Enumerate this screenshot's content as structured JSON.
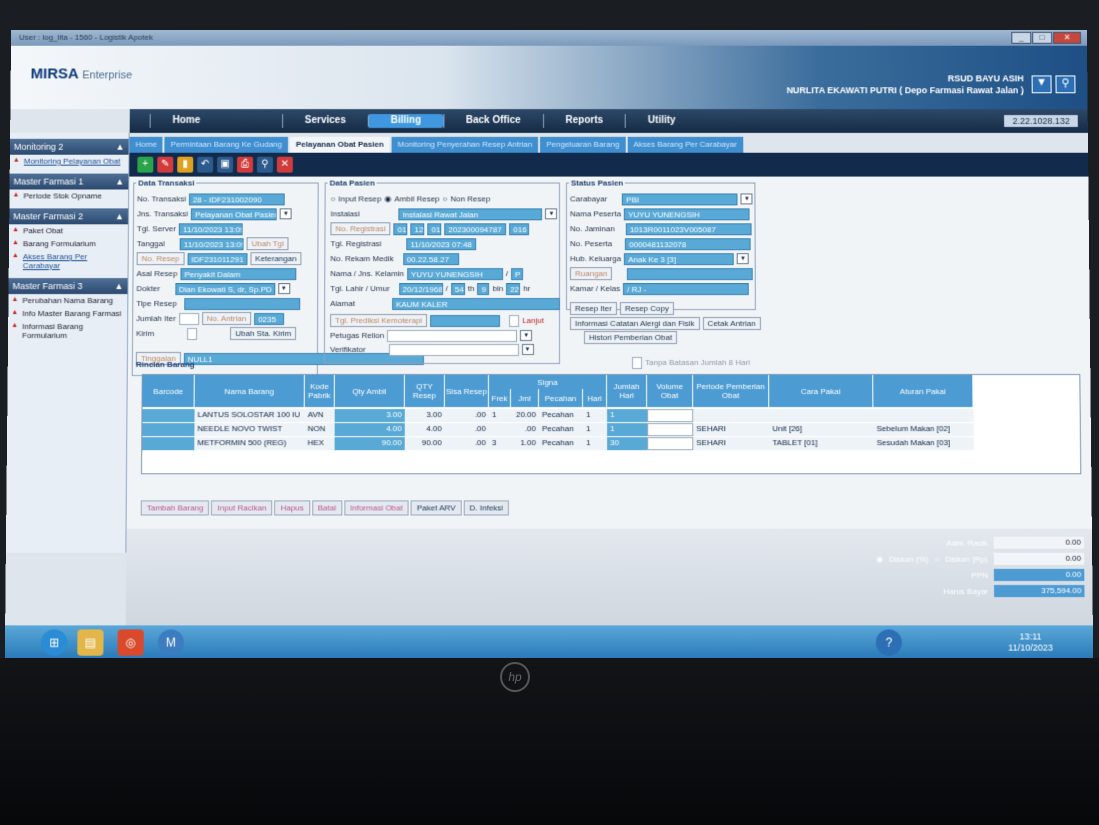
{
  "window": {
    "title": "User : log_lita - 1560 - Logistik Apotek"
  },
  "header": {
    "logo": "MIRSA",
    "logo_sub": "Enterprise",
    "hospital": "RSUD BAYU ASIH",
    "user": "NURLITA EKAWATI PUTRI ( Depo Farmasi Rawat Jalan )"
  },
  "menu": {
    "items": [
      "Home",
      "Services",
      "Billing",
      "Back Office",
      "Reports",
      "Utility"
    ],
    "active": "Billing",
    "version": "2.22.1028.132"
  },
  "left": {
    "sections": [
      {
        "title": "Monitoring 2",
        "items": [
          "Monitoring Pelayanan Obat"
        ]
      },
      {
        "title": "Master Farmasi 1",
        "items": [
          "Periode Stok Opname"
        ]
      },
      {
        "title": "Master Farmasi 2",
        "items": [
          "Paket Obat",
          "Barang Formularium",
          "Akses Barang Per Carabayar"
        ]
      },
      {
        "title": "Master Farmasi 3",
        "items": [
          "Perubahan Nama Barang",
          "Info Master Barang Farmasi",
          "Informasi Barang Formularium"
        ]
      }
    ]
  },
  "tabs": [
    "Home",
    "Permintaan Barang Ke Gudang",
    "Pelayanan Obat Pasien",
    "Monitoring Penyerahan Resep Antrian",
    "Pengeluaran Barang",
    "Akses Barang Per Carabayar"
  ],
  "transaksi": {
    "legend": "Data Transaksi",
    "no_label": "No. Transaksi",
    "no": "28 - IDF231002090",
    "jns_label": "Jns. Transaksi",
    "jns": "Pelayanan Obat Pasien",
    "server_label": "Tgl. Server",
    "server": "11/10/2023 13:09",
    "tanggal_label": "Tanggal",
    "tanggal": "11/10/2023 13:09",
    "ubah_tgl": "Ubah Tgl",
    "no_resep_btn": "No. Resep",
    "no_resep": "IDF231011291",
    "keterangan": "Keterangan",
    "asal_label": "Asal Resep",
    "asal": "Penyakit Dalam",
    "dokter_label": "Dokter",
    "dokter": "Dian Ekowati S, dr, Sp.PD",
    "tipe_label": "Tipe Resep",
    "jumlah_label": "Jumlah Iter",
    "no_antrian_btn": "No. Antrian",
    "no_antrian": "0235",
    "kirim_label": "Kirim",
    "ubah_sta": "Ubah Sta. Kirim",
    "tinggalan": "Tinggalan",
    "tinggalan_val": "NULL1"
  },
  "pasien": {
    "legend": "Data Pasien",
    "opt1": "Input Resep",
    "opt2": "Ambil Resep",
    "opt3": "Non Resep",
    "instalasi_label": "Instalasi",
    "instalasi": "Instalasi Rawat Jalan",
    "no_reg_btn": "No. Registrasi",
    "reg1": "01",
    "reg2": "12",
    "reg3": "01",
    "reg4": "202300094787",
    "reg5": "016",
    "tgl_reg_label": "Tgl. Registrasi",
    "tgl_reg": "11/10/2023 07:48",
    "rm_label": "No. Rekam Medik",
    "rm": "00.22.58.27",
    "nama_label": "Nama / Jns. Kelamin",
    "nama": "YUYU YUNENGSIH",
    "jk": "P",
    "lahir_label": "Tgl. Lahir / Umur",
    "lahir": "20/12/1968",
    "th": "54",
    "th_lbl": "th",
    "bln": "9",
    "bln_lbl": "bln",
    "hr": "22",
    "hr_lbl": "hr",
    "alamat_label": "Alamat",
    "alamat": "KAUM KALER",
    "kemoterapi": "Tgl. Prediksi Kemoterapi",
    "lanjut": "Lanjut",
    "petugas_label": "Petugas Relion",
    "verif_label": "Verifikator"
  },
  "status": {
    "legend": "Status Pasien",
    "carabayar_label": "Carabayar",
    "carabayar": "PBI",
    "nama_peserta_label": "Nama Peserta",
    "nama_peserta": "YUYU YUNENGSIH",
    "jaminan_label": "No. Jaminan",
    "jaminan": "1013R0011023V005087",
    "peserta_label": "No. Peserta",
    "peserta": "0000481132078",
    "hub_label": "Hub. Keluarga",
    "hub": "Anak Ke 3 [3]",
    "ruangan_btn": "Ruangan",
    "kamar_label": "Kamar / Kelas",
    "kamar": "/ RJ -",
    "resep_iter": "Resep Iter",
    "resep_copy": "Resep Copy",
    "alergi": "Informasi Catatan Alergi dan Fisik",
    "cetak": "Cetak Antrian",
    "histori": "Histori Pemberian Obat",
    "tanpa_batasan": "Tanpa Batasan Jumlah 8 Hari"
  },
  "grid": {
    "legend": "Rincian Barang",
    "headers": [
      "Barcode",
      "Nama Barang",
      "Kode Pabrik",
      "Qty Ambil",
      "QTY Resep",
      "Sisa Resep",
      "Frek",
      "Jml",
      "Pecahan",
      "Hari",
      "Jumlah Hari",
      "Volume Obat",
      "Periode Pemberian Obat",
      "Cara Pakai",
      "Aturan Pakai"
    ],
    "signa": "Signa",
    "rows": [
      {
        "nama": "LANTUS SOLOSTAR 100 IU",
        "pabrik": "AVN",
        "qty": "3.00",
        "resep": "3.00",
        "sisa": ".00",
        "frek": "1",
        "x": "X",
        "jml": "20.00",
        "pec": "Pecahan",
        "hari": "1",
        "jh": "1",
        "periode": "",
        "cara": "",
        "aturan": ""
      },
      {
        "nama": "NEEDLE NOVO TWIST",
        "pabrik": "NON",
        "qty": "4.00",
        "resep": "4.00",
        "sisa": ".00",
        "frek": "",
        "x": "X",
        "jml": ".00",
        "pec": "Pecahan",
        "hari": "1",
        "jh": "1",
        "periode": "SEHARI",
        "cara": "Unit [26]",
        "aturan": "Sebelum Makan [02]"
      },
      {
        "nama": "METFORMIN 500 (REG)",
        "pabrik": "HEX",
        "qty": "90.00",
        "resep": "90.00",
        "sisa": ".00",
        "frek": "3",
        "x": "X",
        "jml": "1.00",
        "pec": "Pecahan",
        "hari": "1",
        "jh": "30",
        "periode": "SEHARI",
        "cara": "TABLET [01]",
        "aturan": "Sesudah Makan [03]"
      }
    ]
  },
  "bottom": [
    "Tambah Barang",
    "Input Racikan",
    "Hapus",
    "Batal",
    "Informasi Obat",
    "Paket ARV",
    "D. Infeksi"
  ],
  "summary": {
    "adm_label": "Adm. Racik",
    "adm": "0.00",
    "diskon_opt1": "Diskon (%)",
    "diskon_opt2": "Diskon (Rp)",
    "diskon": "0.00",
    "ppn_label": "PPN",
    "ppn": "0.00",
    "harus_label": "Harus Bayar",
    "harus": "375,594.00"
  },
  "taskbar": {
    "time": "13:11",
    "date": "11/10/2023"
  },
  "brand": "hp"
}
